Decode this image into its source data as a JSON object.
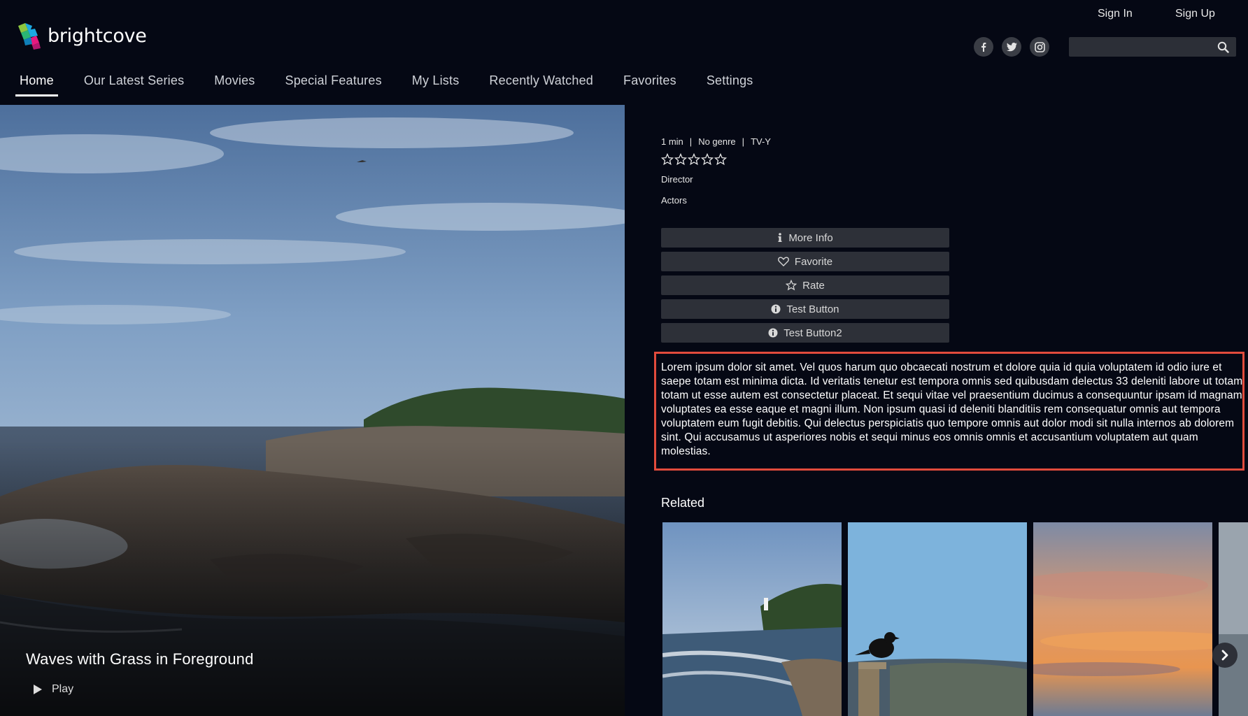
{
  "brand": {
    "name": "brightcove"
  },
  "header": {
    "sign_in": "Sign In",
    "sign_up": "Sign Up",
    "social": [
      {
        "icon": "facebook-icon"
      },
      {
        "icon": "twitter-icon"
      },
      {
        "icon": "instagram-icon"
      }
    ],
    "search": {
      "placeholder": "",
      "value": ""
    }
  },
  "nav": {
    "items": [
      {
        "label": "Home",
        "active": true
      },
      {
        "label": "Our Latest Series",
        "active": false
      },
      {
        "label": "Movies",
        "active": false
      },
      {
        "label": "Special Features",
        "active": false
      },
      {
        "label": "My Lists",
        "active": false
      },
      {
        "label": "Recently Watched",
        "active": false
      },
      {
        "label": "Favorites",
        "active": false
      },
      {
        "label": "Settings",
        "active": false
      }
    ]
  },
  "hero": {
    "title": "Waves with Grass in Foreground",
    "play_label": "Play"
  },
  "details": {
    "duration": "1 min",
    "genre": "No genre",
    "rating": "TV-Y",
    "meta_separator": "|",
    "stars_total": 5,
    "stars_filled": 0,
    "director_label": "Director",
    "actors_label": "Actors",
    "actions": [
      {
        "label": "More Info",
        "icon": "info-icon"
      },
      {
        "label": "Favorite",
        "icon": "heart-icon"
      },
      {
        "label": "Rate",
        "icon": "star-icon"
      },
      {
        "label": "Test Button",
        "icon": "info-circle-icon"
      },
      {
        "label": "Test Button2",
        "icon": "info-circle-icon"
      }
    ],
    "description": "Lorem ipsum dolor sit amet. Vel quos harum quo obcaecati nostrum et dolore quia id quia voluptatem id odio iure et saepe totam est minima dicta. Id veritatis tenetur est tempora omnis sed quibusdam delectus 33 deleniti labore ut totam totam ut esse autem est consectetur placeat. Et sequi vitae vel praesentium ducimus a consequuntur ipsam id magnam voluptates ea esse eaque et magni illum. Non ipsum quasi id deleniti blanditiis rem consequatur omnis aut tempora voluptatem eum fugit debitis. Qui delectus perspiciatis quo tempore omnis aut dolor modi sit nulla internos ab dolorem sint. Qui accusamus ut asperiores nobis et sequi minus eos omnis omnis et accusantium voluptatem aut quam molestias."
  },
  "related": {
    "title": "Related",
    "items": [
      {
        "name": "lighthouse-coast-thumbnail"
      },
      {
        "name": "crow-on-post-thumbnail"
      },
      {
        "name": "sunset-sky-thumbnail"
      },
      {
        "name": "partial-thumbnail"
      }
    ]
  },
  "colors": {
    "background": "#050814",
    "button_bg": "#2d3038",
    "highlight_border": "#e24b3c",
    "logo_green": "#8cc63f",
    "logo_blue": "#1ba9e1",
    "logo_pink": "#e6197e"
  }
}
